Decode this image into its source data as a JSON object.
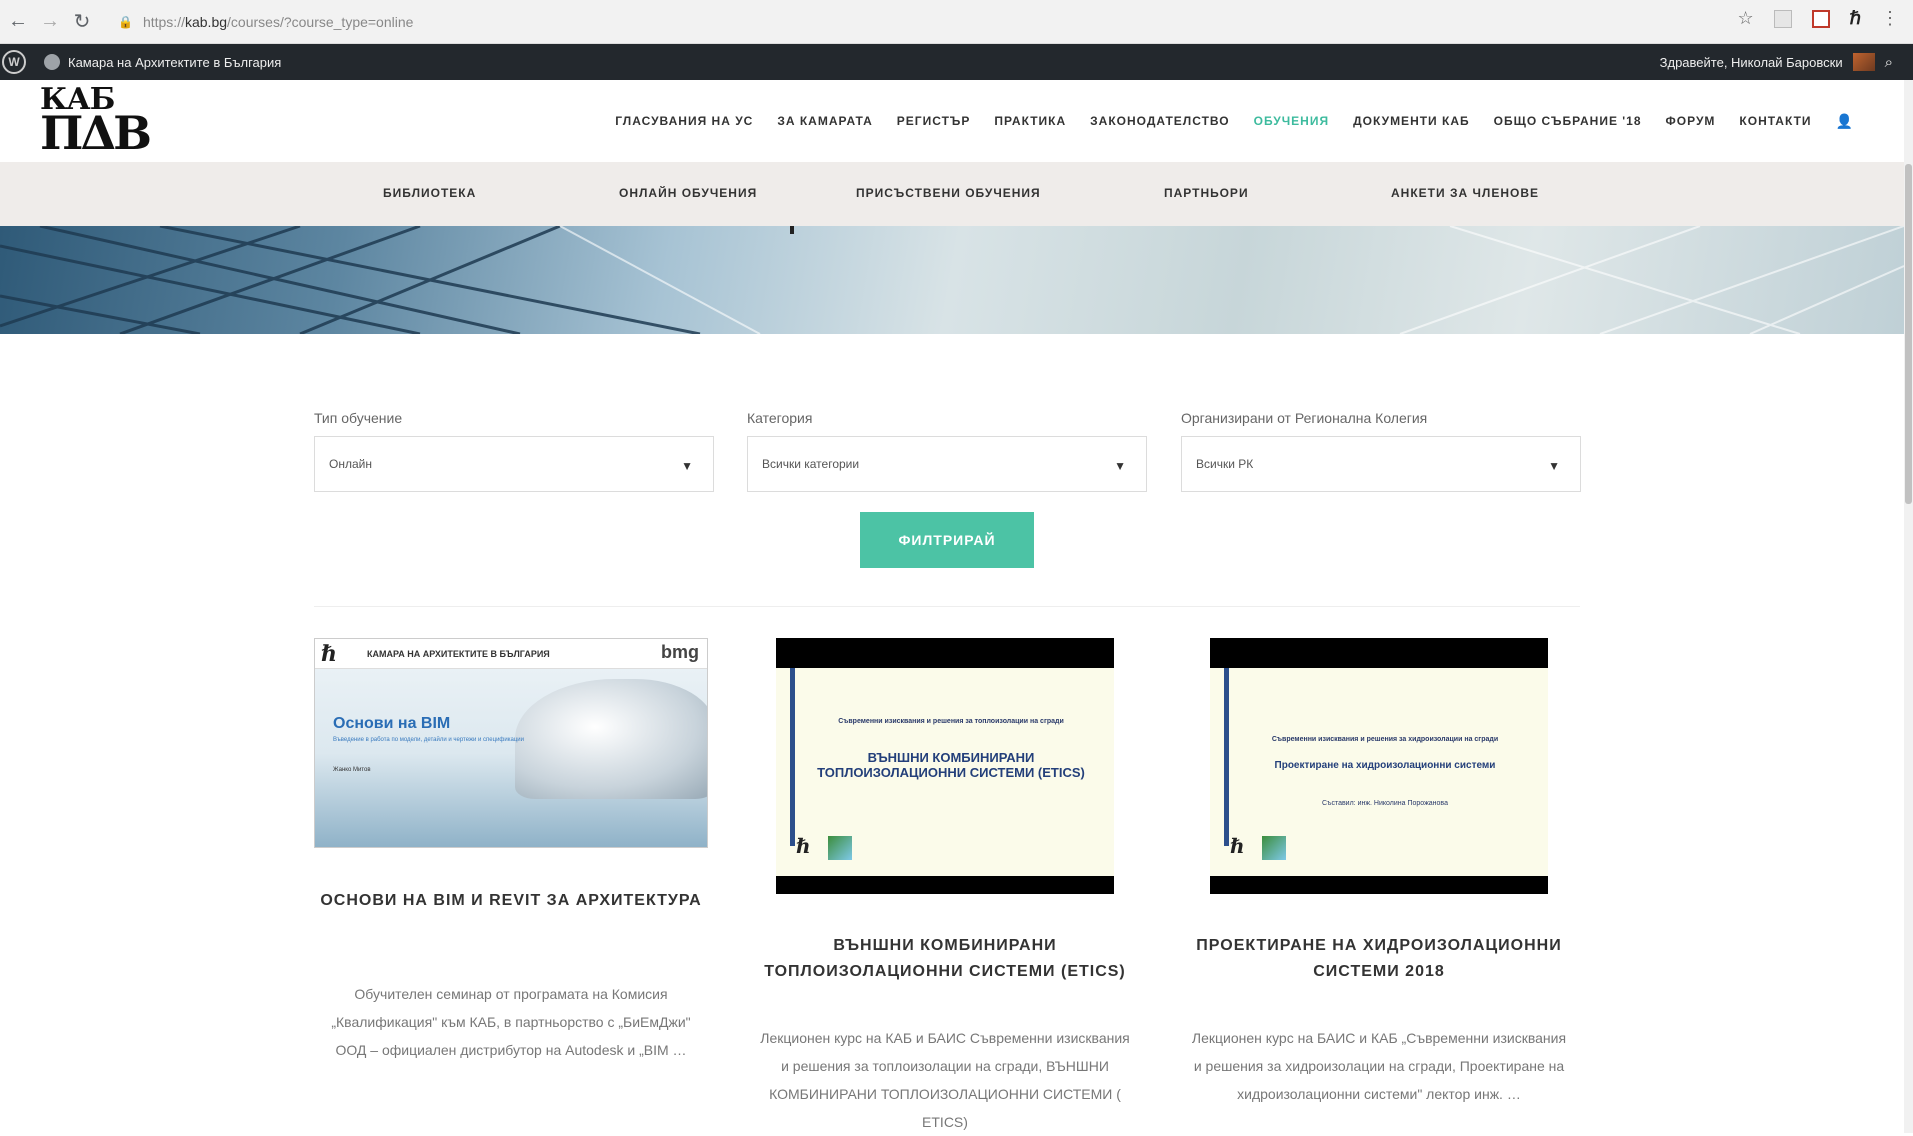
{
  "browser": {
    "url_scheme": "https://",
    "url_host": "kab.bg",
    "url_path": "/courses/?course_type=online"
  },
  "admin_bar": {
    "site_name": "Камара на Архитектите в България",
    "greeting": "Здравейте, Николай Баровски"
  },
  "logo": {
    "top": "КАБ",
    "bottom": "ΠΔΒ"
  },
  "main_nav": [
    {
      "label": "ГЛАСУВАНИЯ НА УС",
      "active": false
    },
    {
      "label": "ЗА КАМАРАТА",
      "active": false
    },
    {
      "label": "РЕГИСТЪР",
      "active": false
    },
    {
      "label": "ПРАКТИКА",
      "active": false
    },
    {
      "label": "ЗАКОНОДАТЕЛСТВО",
      "active": false
    },
    {
      "label": "ОБУЧЕНИЯ",
      "active": true
    },
    {
      "label": "ДОКУМЕНТИ КАБ",
      "active": false
    },
    {
      "label": "ОБЩО СЪБРАНИЕ '18",
      "active": false
    },
    {
      "label": "ФОРУМ",
      "active": false
    },
    {
      "label": "КОНТАКТИ",
      "active": false
    }
  ],
  "sub_nav": [
    {
      "label": "БИБЛИОТЕКА"
    },
    {
      "label": "ОНЛАЙН ОБУЧЕНИЯ"
    },
    {
      "label": "ПРИСЪСТВЕНИ ОБУЧЕНИЯ"
    },
    {
      "label": "ПАРТНЬОРИ"
    },
    {
      "label": "АНКЕТИ ЗА ЧЛЕНОВЕ"
    }
  ],
  "filters": {
    "type": {
      "label": "Тип обучение",
      "value": "Онлайн"
    },
    "category": {
      "label": "Категория",
      "value": "Всички категории"
    },
    "region": {
      "label": "Организирани от Регионална Колегия",
      "value": "Всички РК"
    },
    "button": "ФИЛТРИРАЙ"
  },
  "courses": [
    {
      "title": "ОСНОВИ НА BIM И REVIT ЗА АРХИТЕКТУРА",
      "description": "Обучителен семинар от програмата на Комисия „Квалификация\" към КАБ, в партньорство с „БиЕмДжи\" ООД – официален дистрибутор на Autodesk и „BIM …",
      "thumb": {
        "header": "КАМАРА НА АРХИТЕКТИТЕ В БЪЛГАРИЯ",
        "brand": "bmg",
        "heading": "Основи на BIM",
        "subtitle": "Въведение в работа по модели, детайли и чертежи и спецификации",
        "author": "Жанко Митов"
      }
    },
    {
      "title": "ВЪНШНИ КОМБИНИРАНИ ТОПЛОИЗОЛАЦИОННИ СИСТЕМИ (ETICS)",
      "description": "Лекционен курс на КАБ и БАИС Съвременни изисквания и решения за топлоизолации на сгради, ВЪНШНИ КОМБИНИРАНИ ТОПЛОИЗОЛАЦИОННИ СИСТЕМИ ( ETICS)",
      "thumb": {
        "small": "Съвременни изисквания и решения за топлоизолации на сгради",
        "big": "ВЪНШНИ КОМБИНИРАНИ ТОПЛОИЗОЛАЦИОННИ СИСТЕМИ (ETICS)"
      }
    },
    {
      "title": "ПРОЕКТИРАНЕ НА ХИДРОИЗОЛАЦИОННИ СИСТЕМИ 2018",
      "description": "Лекционен курс на БАИС и КАБ „Съвременни изисквания и решения за хидроизолации на сгради, Проектиране на хидроизолационни системи\" лектор инж. …",
      "thumb": {
        "small": "Съвременни изисквания и решения за хидроизолации на сгради",
        "big": "Проектиране на хидроизолационни системи",
        "author": "Съставил: инж. Николина Порожанова"
      }
    }
  ],
  "colors": {
    "accent": "#4cc3a5",
    "admin_bar": "#23282d",
    "sub_nav_bg": "#efecea"
  }
}
